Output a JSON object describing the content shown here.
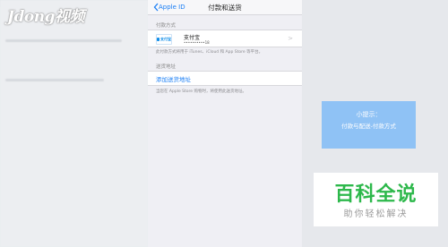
{
  "watermark": {
    "text": "Jdong视频"
  },
  "navbar": {
    "back_label": "Apple ID",
    "title": "付款和送货"
  },
  "payment": {
    "section_header": "付款方式",
    "method_logo": "支付宝",
    "method_name": "支付宝",
    "account": "••••••••••18",
    "footnote": "此付款方式将用于 iTunes、iCloud 和 App Store 等平台。"
  },
  "shipping": {
    "section_header": "送货地址",
    "add_label": "添加送货地址",
    "footnote": "当您在 Apple Store 购物时，将使用此送货地址。"
  },
  "tip": {
    "title": "小提示：",
    "body": "付款与配送-付款方式"
  },
  "baike": {
    "title": "百科全说",
    "subtitle": "助你轻松解决"
  },
  "colors": {
    "link": "#1a7ef5",
    "tip_bg": "#8fc2f5",
    "baike_green": "#2db84b"
  },
  "icons": {
    "back": "chevron-left-icon",
    "row_disclosure": "chevron-right-icon",
    "payment": "alipay-icon"
  }
}
